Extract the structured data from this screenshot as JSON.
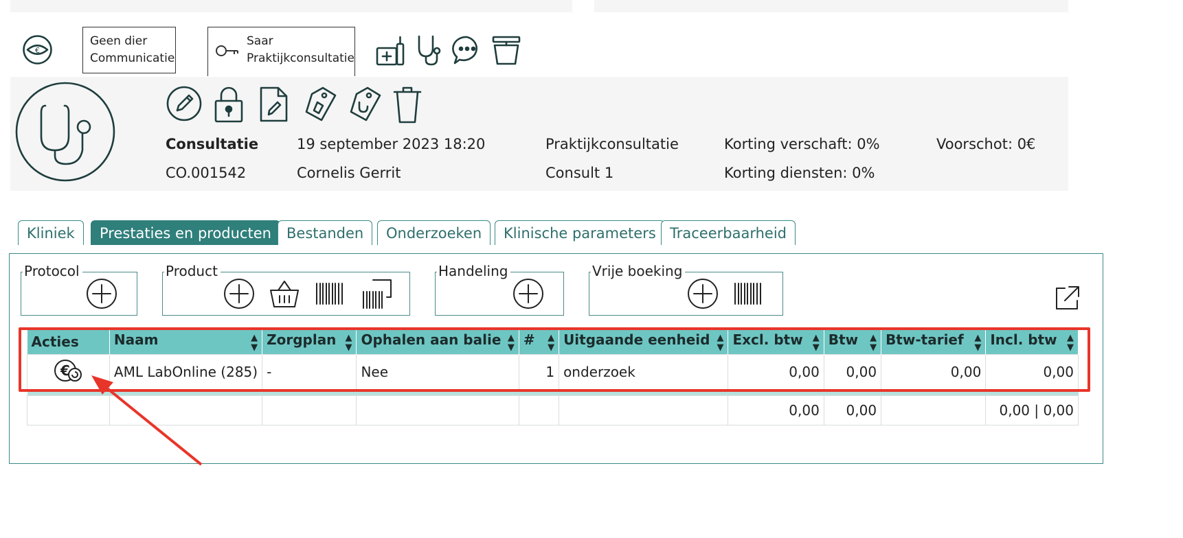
{
  "header": {
    "tags": [
      {
        "line1": "Geen dier",
        "line2": "Communicatie"
      },
      {
        "line1": "Saar",
        "line2": "Praktijkconsultatie"
      }
    ]
  },
  "consult": {
    "type": "Consultatie",
    "code": "CO.001542",
    "datetime": "19 september 2023 18:20",
    "vet": "Cornelis Gerrit",
    "kind": "Praktijkconsultatie",
    "consult_nr": "Consult 1",
    "discount_goods": "Korting verschaft: 0%",
    "discount_services": "Korting diensten: 0%",
    "deposit": "Voorschot: 0€"
  },
  "tabs": [
    "Kliniek",
    "Prestaties en producten",
    "Bestanden",
    "Onderzoeken",
    "Klinische parameters",
    "Traceerbaarheid"
  ],
  "active_tab": "Prestaties en producten",
  "groups": {
    "protocol": "Protocol",
    "product": "Product",
    "handeling": "Handeling",
    "vrije_boeking": "Vrije boeking"
  },
  "table": {
    "columns": [
      "Acties",
      "Naam",
      "Zorgplan",
      "Ophalen aan balie",
      "#",
      "Uitgaande eenheid",
      "Excl. btw",
      "Btw",
      "Btw-tarief",
      "Incl. btw"
    ],
    "rows": [
      {
        "naam": "AML LabOnline (285)",
        "zorgplan": "-",
        "ophalen": "Nee",
        "aantal": "1",
        "eenheid": "onderzoek",
        "excl": "0,00",
        "btw": "0,00",
        "tarief": "0,00",
        "incl": "0,00"
      }
    ],
    "totals": {
      "excl": "0,00",
      "btw": "0,00",
      "incl": "0,00 | 0,00"
    }
  },
  "annotation": {
    "highlight_color": "#e8352a"
  },
  "colors": {
    "accent": "#2f7f7b",
    "header": "#6ec6c3",
    "icon": "#1f3d3d"
  }
}
